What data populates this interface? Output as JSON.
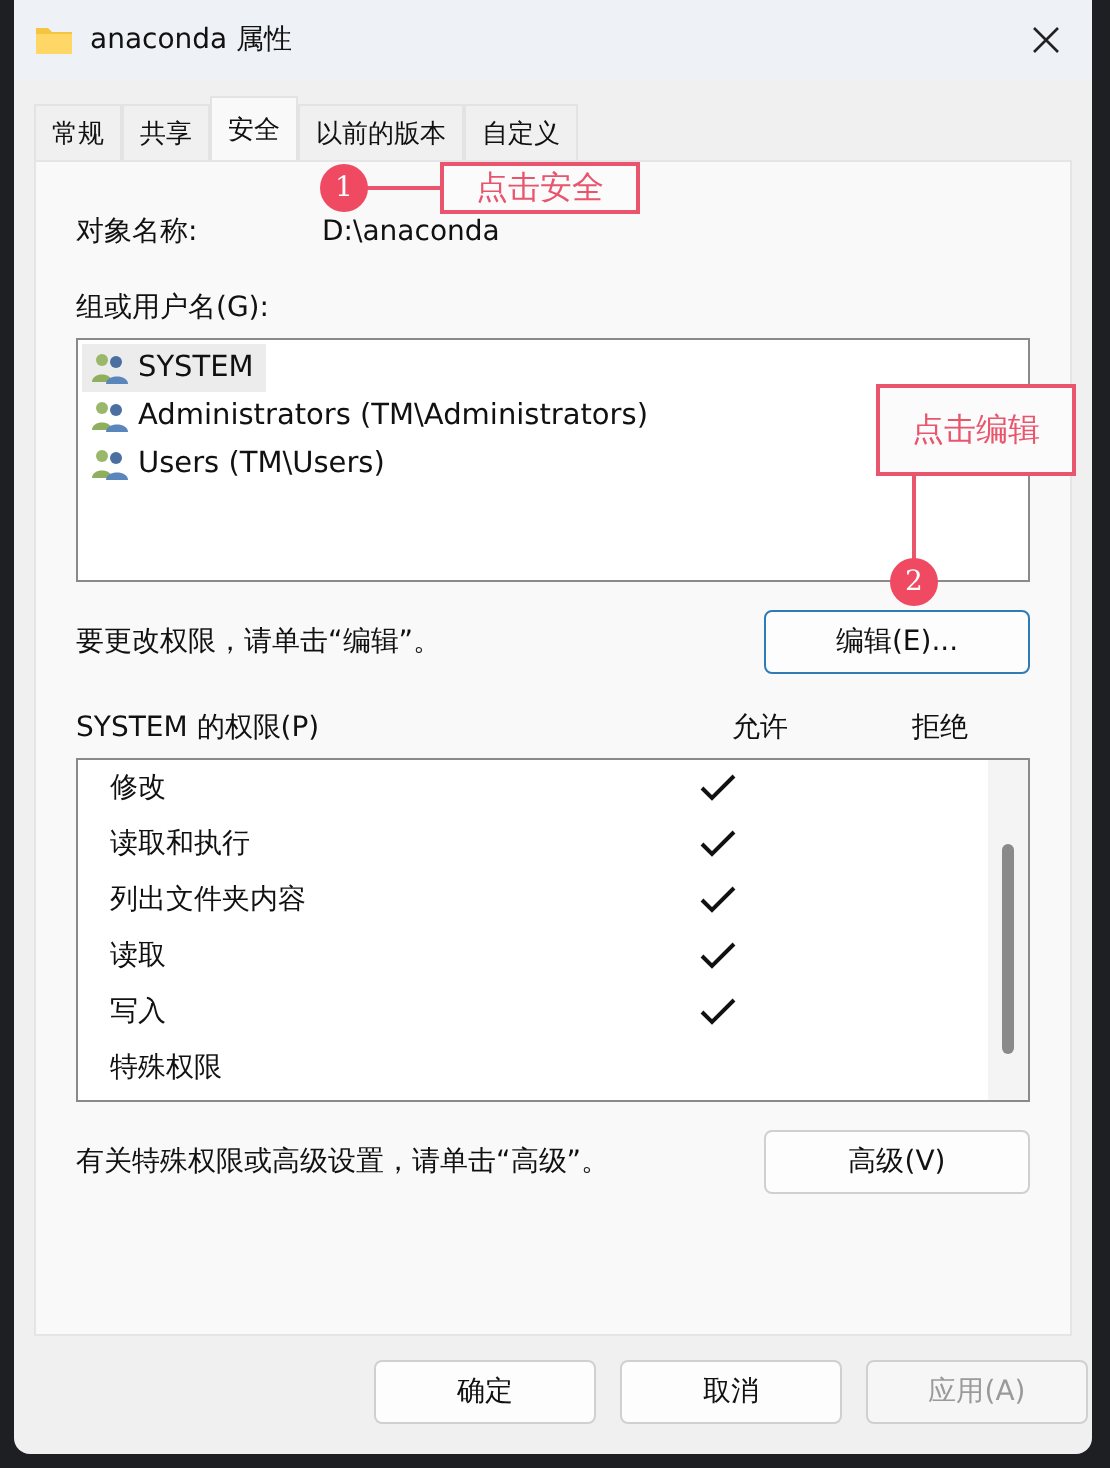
{
  "window": {
    "title": "anaconda 属性"
  },
  "tabs": [
    {
      "label": "常规",
      "selected": false
    },
    {
      "label": "共享",
      "selected": false
    },
    {
      "label": "安全",
      "selected": true
    },
    {
      "label": "以前的版本",
      "selected": false
    },
    {
      "label": "自定义",
      "selected": false
    }
  ],
  "object_name": {
    "label": "对象名称:",
    "value": "D:\\anaconda"
  },
  "groups": {
    "label": "组或用户名(G):",
    "items": [
      {
        "name": "SYSTEM",
        "selected": true
      },
      {
        "name": "Administrators (TM\\Administrators)",
        "selected": false
      },
      {
        "name": "Users (TM\\Users)",
        "selected": false
      }
    ]
  },
  "edit_hint": "要更改权限，请单击“编辑”。",
  "edit_button": "编辑(E)...",
  "permissions": {
    "label": "SYSTEM 的权限(P)",
    "allow_header": "允许",
    "deny_header": "拒绝",
    "rows": [
      {
        "name": "修改",
        "allow": true,
        "deny": false
      },
      {
        "name": "读取和执行",
        "allow": true,
        "deny": false
      },
      {
        "name": "列出文件夹内容",
        "allow": true,
        "deny": false
      },
      {
        "name": "读取",
        "allow": true,
        "deny": false
      },
      {
        "name": "写入",
        "allow": true,
        "deny": false
      },
      {
        "name": "特殊权限",
        "allow": false,
        "deny": false
      }
    ]
  },
  "advanced_hint": "有关特殊权限或高级设置，请单击“高级”。",
  "advanced_button": "高级(V)",
  "buttons": [
    {
      "label": "确定",
      "disabled": false
    },
    {
      "label": "取消",
      "disabled": false
    },
    {
      "label": "应用(A)",
      "disabled": true
    }
  ],
  "annotations": [
    {
      "number": "1",
      "text": "点击安全"
    },
    {
      "number": "2",
      "text": "点击编辑"
    }
  ]
}
